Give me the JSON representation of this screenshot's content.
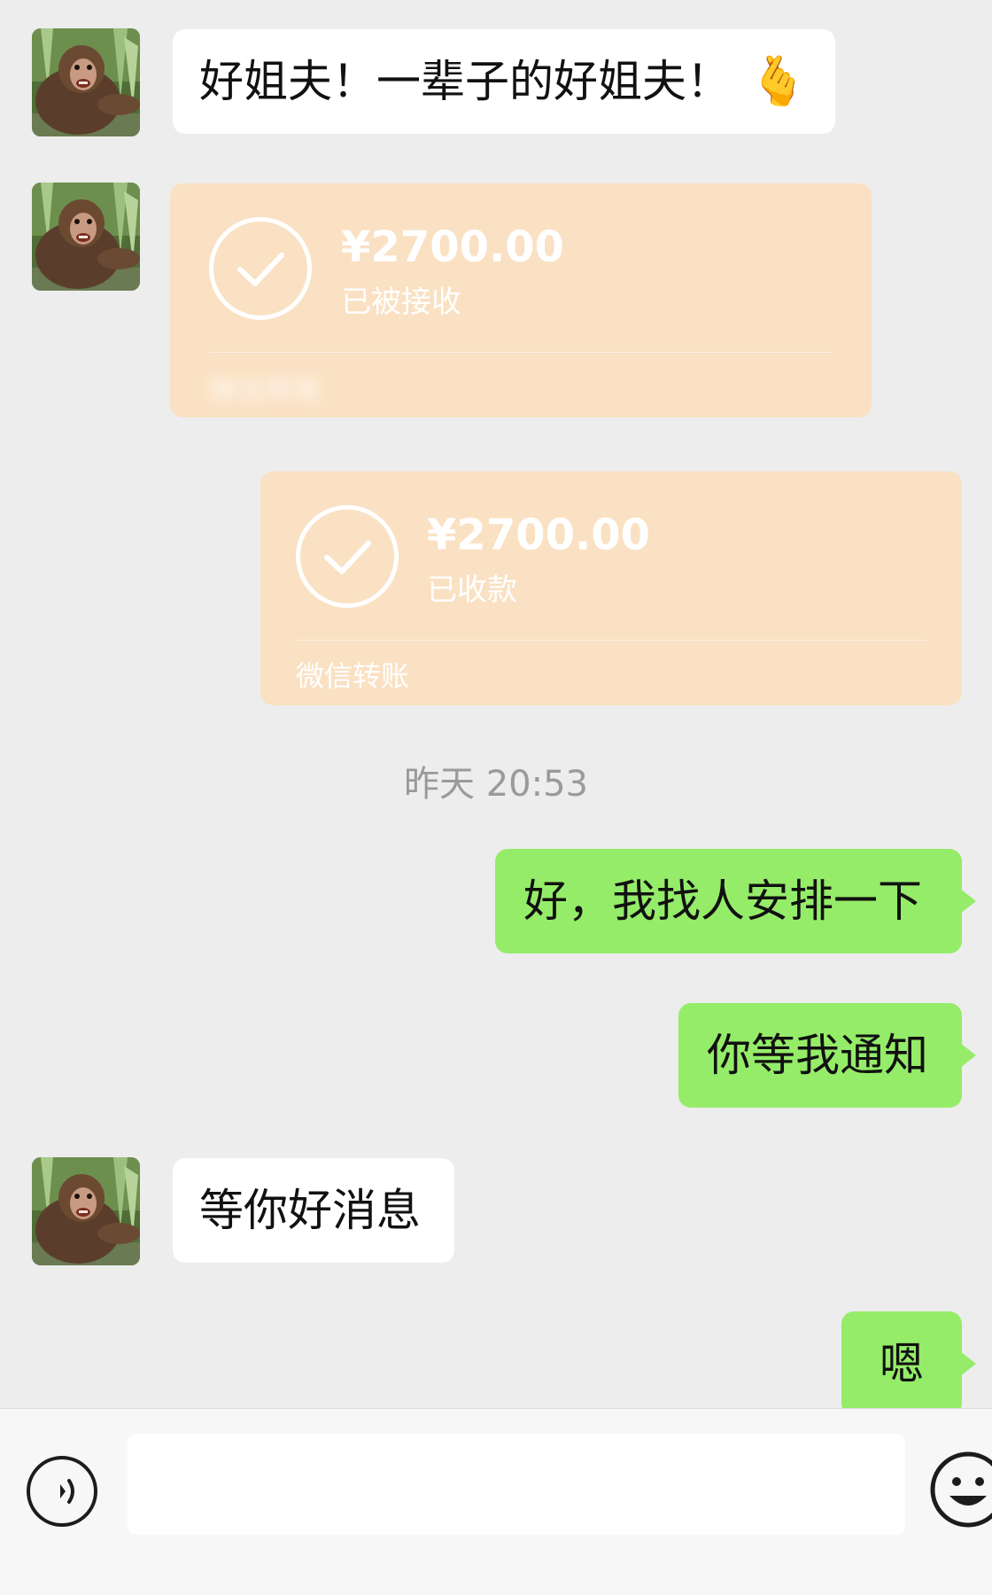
{
  "messages": [
    {
      "side": "incoming",
      "type": "text",
      "text": "好姐夫！一辈子的好姐夫！",
      "emoji": "🫰"
    },
    {
      "side": "incoming",
      "type": "transfer",
      "amount": "¥2700.00",
      "status": "已被接收",
      "footer": "微信转账"
    },
    {
      "side": "outgoing",
      "type": "transfer",
      "amount": "¥2700.00",
      "status": "已收款",
      "footer": "微信转账"
    },
    {
      "type": "timestamp",
      "text": "昨天 20:53"
    },
    {
      "side": "outgoing",
      "type": "text",
      "text": "好，我找人安排一下"
    },
    {
      "side": "outgoing",
      "type": "text",
      "text": "你等我通知"
    },
    {
      "side": "incoming",
      "type": "text",
      "text": "等你好消息"
    },
    {
      "side": "outgoing",
      "type": "text",
      "text": "嗯"
    }
  ],
  "input_bar": {
    "left_icon": "voice-icon",
    "input_value": "",
    "right_icon": "emoji-icon"
  },
  "colors": {
    "background": "#ededed",
    "incoming_bubble": "#ffffff",
    "outgoing_bubble": "#95ec69",
    "transfer_card": "#fae1c3",
    "timestamp_text": "#9a9a9a"
  }
}
